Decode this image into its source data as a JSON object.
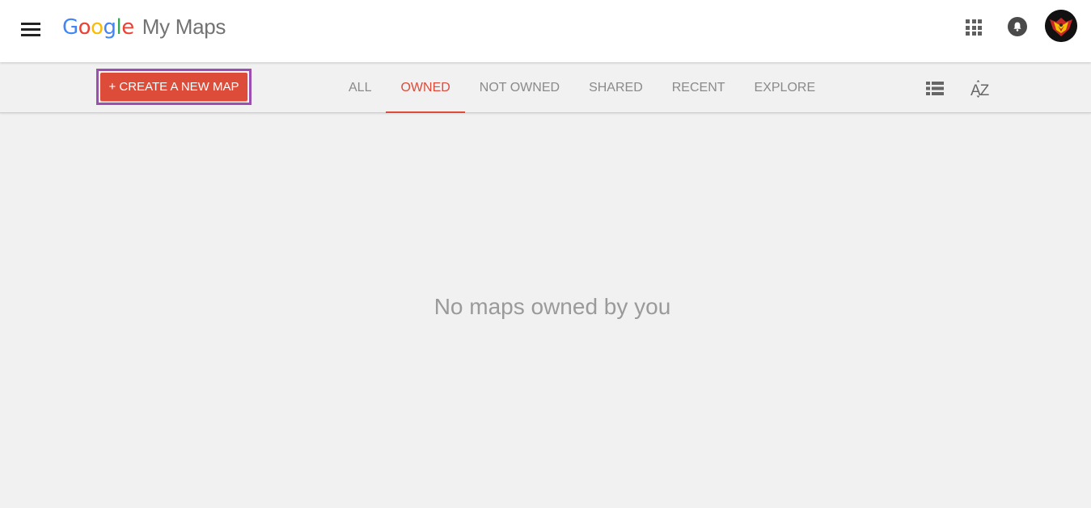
{
  "header": {
    "logo_parts": [
      {
        "text": "G",
        "color": "#4285F4"
      },
      {
        "text": "o",
        "color": "#EA4335"
      },
      {
        "text": "o",
        "color": "#FBBC05"
      },
      {
        "text": "g",
        "color": "#4285F4"
      },
      {
        "text": "l",
        "color": "#34A853"
      },
      {
        "text": "e",
        "color": "#EA4335"
      }
    ],
    "product_name": "My Maps",
    "icons": [
      "menu-icon",
      "apps-grid-icon",
      "notifications-bell-icon",
      "account-avatar"
    ]
  },
  "toolbar": {
    "create_label": "+ CREATE A NEW MAP",
    "tabs": [
      {
        "label": "ALL",
        "active": false
      },
      {
        "label": "OWNED",
        "active": true
      },
      {
        "label": "NOT OWNED",
        "active": false
      },
      {
        "label": "SHARED",
        "active": false
      },
      {
        "label": "RECENT",
        "active": false
      },
      {
        "label": "EXPLORE",
        "active": false
      }
    ],
    "sort_icon_text": "AZ",
    "icons": [
      "list-view-icon",
      "sort-az-icon"
    ]
  },
  "main": {
    "empty_message": "No maps owned by you"
  },
  "colors": {
    "accent": "#dd4b39",
    "highlight_border": "#9c4fb0",
    "background": "#f1f1f1",
    "header_bg": "#ffffff",
    "tab_inactive": "#8a8a8a",
    "empty_text": "#9a9a9a"
  }
}
